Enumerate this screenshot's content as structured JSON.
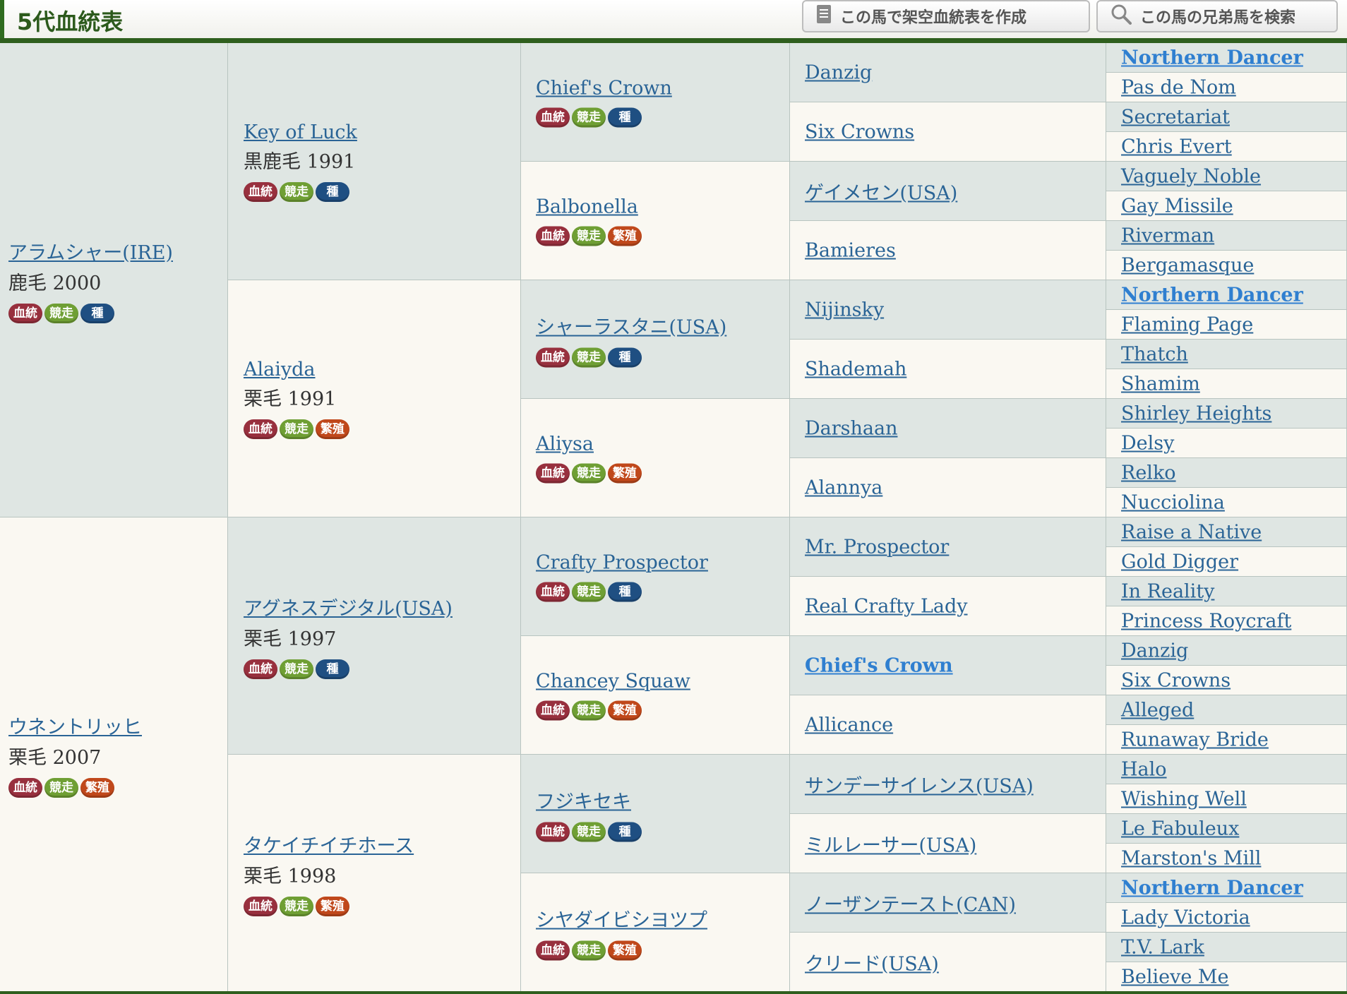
{
  "header": {
    "title": "5代血統表",
    "buttons": [
      {
        "label": "この馬で架空血統表を作成",
        "icon": "document-icon"
      },
      {
        "label": "この馬の兄弟馬を検索",
        "icon": "search-icon"
      }
    ]
  },
  "badges": {
    "ketto": "血統",
    "kyoso": "競走",
    "shubo": "種",
    "hanshoku": "繁殖"
  },
  "colors": {
    "header_green": "#2c5a1c",
    "link": "#2a6496",
    "cell_blue": "#dfe6e3",
    "cell_cream": "#faf8f2",
    "badge_ketto": "#98303e",
    "badge_kyoso": "#6f9f34",
    "badge_shu": "#1f4f82",
    "badge_hanshoku": "#c0481b"
  },
  "gen1": [
    {
      "name": "アラムシャー(IRE)",
      "info": "鹿毛 2000",
      "badges": [
        "ketto",
        "kyoso",
        "shubo"
      ]
    },
    {
      "name": "ウネントリッヒ",
      "info": "栗毛 2007",
      "badges": [
        "ketto",
        "kyoso",
        "hanshoku"
      ]
    }
  ],
  "gen2": [
    {
      "name": "Key of Luck",
      "info": "黒鹿毛 1991",
      "badges": [
        "ketto",
        "kyoso",
        "shubo"
      ]
    },
    {
      "name": "Alaiyda",
      "info": "栗毛 1991",
      "badges": [
        "ketto",
        "kyoso",
        "hanshoku"
      ]
    },
    {
      "name": "アグネスデジタル(USA)",
      "info": "栗毛 1997",
      "badges": [
        "ketto",
        "kyoso",
        "shubo"
      ]
    },
    {
      "name": "タケイチイチホース",
      "info": "栗毛 1998",
      "badges": [
        "ketto",
        "kyoso",
        "hanshoku"
      ]
    }
  ],
  "gen3": [
    {
      "name": "Chief's Crown",
      "badges": [
        "ketto",
        "kyoso",
        "shubo"
      ]
    },
    {
      "name": "Balbonella",
      "badges": [
        "ketto",
        "kyoso",
        "hanshoku"
      ]
    },
    {
      "name": "シャーラスタニ(USA)",
      "badges": [
        "ketto",
        "kyoso",
        "shubo"
      ]
    },
    {
      "name": "Aliysa",
      "badges": [
        "ketto",
        "kyoso",
        "hanshoku"
      ]
    },
    {
      "name": "Crafty Prospector",
      "badges": [
        "ketto",
        "kyoso",
        "shubo"
      ]
    },
    {
      "name": "Chancey Squaw",
      "badges": [
        "ketto",
        "kyoso",
        "hanshoku"
      ]
    },
    {
      "name": "フジキセキ",
      "badges": [
        "ketto",
        "kyoso",
        "shubo"
      ]
    },
    {
      "name": "シヤダイビシヨツプ",
      "badges": [
        "ketto",
        "kyoso",
        "hanshoku"
      ]
    }
  ],
  "gen4": [
    {
      "name": "Danzig"
    },
    {
      "name": "Six Crowns"
    },
    {
      "name": "ゲイメセン(USA)"
    },
    {
      "name": "Bamieres"
    },
    {
      "name": "Nijinsky"
    },
    {
      "name": "Shademah"
    },
    {
      "name": "Darshaan"
    },
    {
      "name": "Alannya"
    },
    {
      "name": "Mr. Prospector"
    },
    {
      "name": "Real Crafty Lady"
    },
    {
      "name": "Chief's Crown",
      "bold": true
    },
    {
      "name": "Allicance"
    },
    {
      "name": "サンデーサイレンス(USA)"
    },
    {
      "name": "ミルレーサー(USA)"
    },
    {
      "name": "ノーザンテースト(CAN)"
    },
    {
      "name": "クリード(USA)"
    }
  ],
  "gen5": [
    {
      "name": "Northern Dancer",
      "bold": true
    },
    {
      "name": "Pas de Nom"
    },
    {
      "name": "Secretariat"
    },
    {
      "name": "Chris Evert"
    },
    {
      "name": "Vaguely Noble"
    },
    {
      "name": "Gay Missile"
    },
    {
      "name": "Riverman"
    },
    {
      "name": "Bergamasque"
    },
    {
      "name": "Northern Dancer",
      "bold": true
    },
    {
      "name": "Flaming Page"
    },
    {
      "name": "Thatch"
    },
    {
      "name": "Shamim"
    },
    {
      "name": "Shirley Heights"
    },
    {
      "name": "Delsy"
    },
    {
      "name": "Relko"
    },
    {
      "name": "Nucciolina"
    },
    {
      "name": "Raise a Native"
    },
    {
      "name": "Gold Digger"
    },
    {
      "name": "In Reality"
    },
    {
      "name": "Princess Roycraft"
    },
    {
      "name": "Danzig"
    },
    {
      "name": "Six Crowns"
    },
    {
      "name": "Alleged"
    },
    {
      "name": "Runaway Bride"
    },
    {
      "name": "Halo"
    },
    {
      "name": "Wishing Well"
    },
    {
      "name": "Le Fabuleux"
    },
    {
      "name": "Marston's Mill"
    },
    {
      "name": "Northern Dancer",
      "bold": true
    },
    {
      "name": "Lady Victoria"
    },
    {
      "name": "T.V. Lark"
    },
    {
      "name": "Believe Me"
    }
  ]
}
